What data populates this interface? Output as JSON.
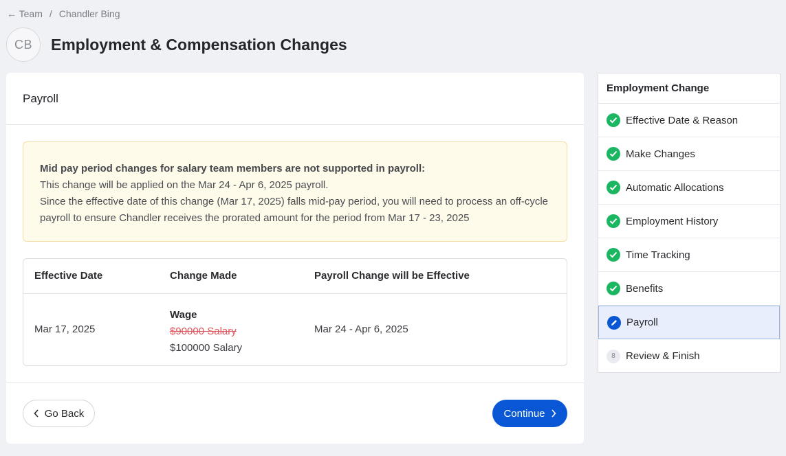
{
  "breadcrumb": {
    "back": "Team",
    "separator": "/",
    "current": "Chandler Bing"
  },
  "header": {
    "avatar_initials": "CB",
    "title": "Employment & Compensation Changes"
  },
  "card": {
    "title": "Payroll",
    "alert": {
      "title": "Mid pay period changes for salary team members are not supported in payroll:",
      "line1": "This change will be applied on the Mar 24 - Apr 6, 2025 payroll.",
      "line2": "Since the effective date of this change (Mar 17, 2025) falls mid-pay period, you will need to process an off-cycle payroll to ensure Chandler receives the prorated amount for the period from Mar 17 - 23, 2025"
    },
    "table": {
      "headers": [
        "Effective Date",
        "Change Made",
        "Payroll Change will be Effective"
      ],
      "row": {
        "effective_date": "Mar 17, 2025",
        "change_label": "Wage",
        "old_value": "$90000 Salary",
        "new_value": "$100000 Salary",
        "payroll_effective": "Mar 24 - Apr 6, 2025"
      }
    },
    "footer": {
      "back_label": "Go Back",
      "continue_label": "Continue"
    }
  },
  "sidebar": {
    "title": "Employment Change",
    "steps": [
      {
        "label": "Effective Date & Reason",
        "state": "done"
      },
      {
        "label": "Make Changes",
        "state": "done"
      },
      {
        "label": "Automatic Allocations",
        "state": "done"
      },
      {
        "label": "Employment History",
        "state": "done"
      },
      {
        "label": "Time Tracking",
        "state": "done"
      },
      {
        "label": "Benefits",
        "state": "done"
      },
      {
        "label": "Payroll",
        "state": "active"
      },
      {
        "label": "Review & Finish",
        "state": "pending",
        "number": "8"
      }
    ]
  },
  "colors": {
    "accent": "#0a57d6",
    "success": "#1bb661",
    "strike": "#e0565f",
    "alert_bg": "#fffbea"
  }
}
